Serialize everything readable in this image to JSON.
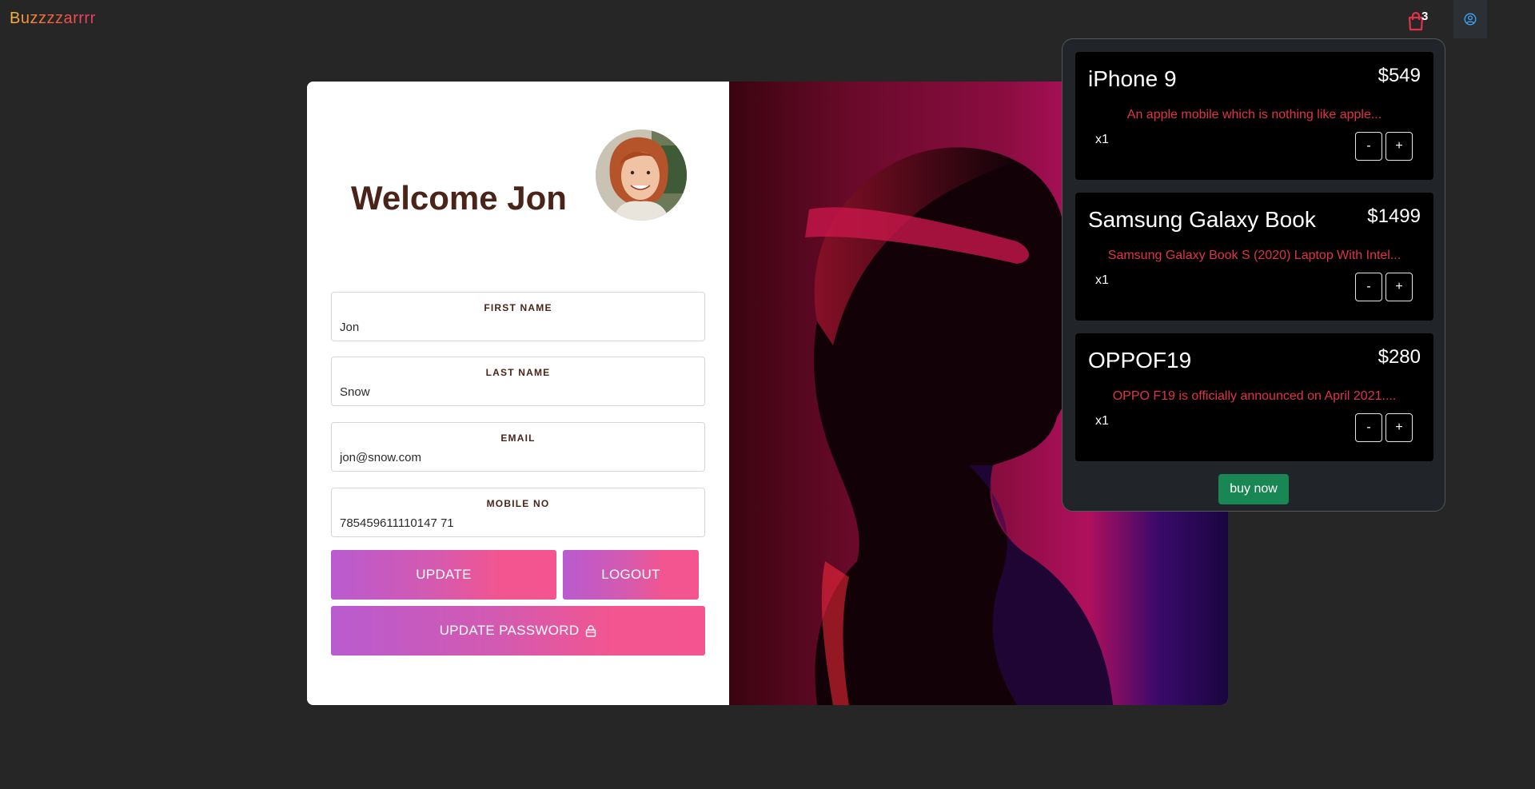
{
  "header": {
    "brand": "Buzzzzarrrr",
    "cart_count": "3",
    "cart_icon": "shopping-bag-icon",
    "user_icon": "user-circle-icon"
  },
  "profile": {
    "welcome": "Welcome Jon",
    "fields": [
      {
        "label": "FIRST NAME",
        "value": "Jon"
      },
      {
        "label": "LAST NAME",
        "value": "Snow"
      },
      {
        "label": "EMAIL",
        "value": "jon@snow.com"
      },
      {
        "label": "MOBILE NO",
        "value": "785459611110147 71"
      }
    ],
    "update_label": "UPDATE",
    "logout_label": "LOGOUT",
    "update_password_label": "UPDATE PASSWORD",
    "lock_icon": "lock-icon"
  },
  "cart": {
    "items": [
      {
        "title": "iPhone 9",
        "price": "$549",
        "description": "An apple mobile which is nothing like apple...",
        "qty": "x1"
      },
      {
        "title": "Samsung Galaxy Book",
        "price": "$1499",
        "description": "Samsung Galaxy Book S (2020) Laptop With Intel...",
        "qty": "x1"
      },
      {
        "title": "OPPOF19",
        "price": "$280",
        "description": "OPPO F19 is officially announced on April 2021....",
        "qty": "x1"
      }
    ],
    "minus_label": "-",
    "plus_label": "+",
    "buy_label": "buy now"
  },
  "colors": {
    "background": "#262626",
    "heading": "#4a2418",
    "accent_red": "#e0334a",
    "buy_green": "#198754",
    "cart_icon": "#e0334a",
    "user_icon": "#3ea6ff"
  }
}
